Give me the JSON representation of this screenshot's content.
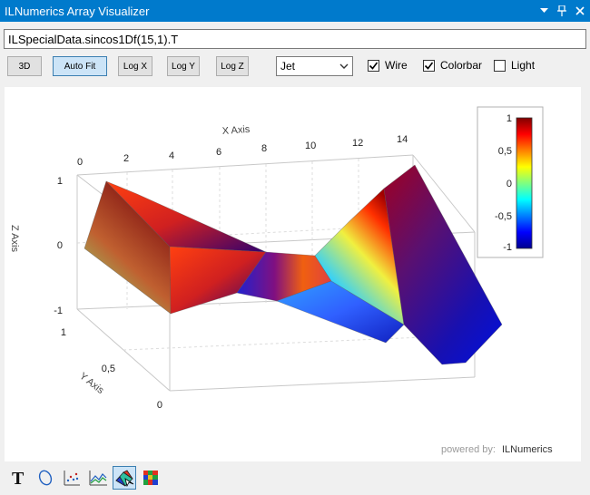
{
  "window": {
    "title": "ILNumerics Array Visualizer",
    "title_bg": "#007acc"
  },
  "expression": {
    "value": "ILSpecialData.sincos1Df(15,1).T"
  },
  "toolbar": {
    "btn_3d": "3D",
    "btn_autofit": "Auto Fit",
    "btn_logx": "Log X",
    "btn_logy": "Log Y",
    "btn_logz": "Log Z",
    "colormap": "Jet",
    "wire_label": "Wire",
    "wire_checked": true,
    "colorbar_label": "Colorbar",
    "colorbar_checked": true,
    "light_label": "Light",
    "light_checked": false
  },
  "plot": {
    "x_axis_label": "X Axis",
    "y_axis_label": "Y Axis",
    "z_axis_label": "Z Axis",
    "x_ticks": [
      "0",
      "2",
      "4",
      "6",
      "8",
      "10",
      "12",
      "14"
    ],
    "y_ticks": [
      "1",
      "0,5",
      "0"
    ],
    "z_ticks": [
      "1",
      "0",
      "-1"
    ],
    "colorbar_ticks": [
      "1",
      "0,5",
      "0",
      "-0,5",
      "-1"
    ],
    "watermark_prefix": "powered by:",
    "watermark_brand": "ILNumerics"
  },
  "chart_data": {
    "type": "surface",
    "x_label": "X Axis",
    "y_label": "Y Axis",
    "z_label": "Z Axis",
    "x_range": [
      0,
      14
    ],
    "y_range": [
      0,
      1
    ],
    "z_range": [
      -1,
      1
    ],
    "colormap": "Jet",
    "colorbar_range": [
      -1,
      1
    ]
  },
  "bottom_tools": [
    {
      "name": "text-tool-icon"
    },
    {
      "name": "ellipse-tool-icon"
    },
    {
      "name": "scatter-tool-icon"
    },
    {
      "name": "line-plot-tool-icon"
    },
    {
      "name": "surface-tool-icon",
      "selected": true
    },
    {
      "name": "imagesc-tool-icon"
    }
  ]
}
